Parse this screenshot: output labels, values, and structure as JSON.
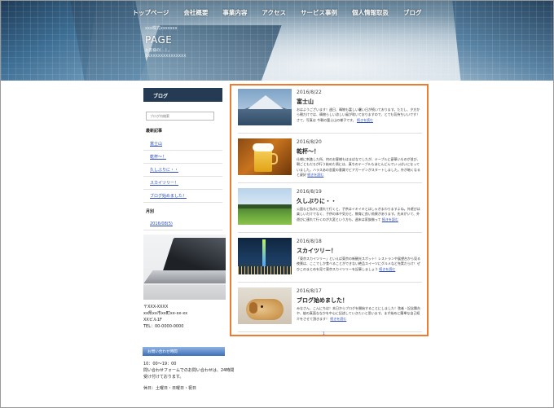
{
  "nav": {
    "items": [
      "トップページ",
      "会社概要",
      "事業内容",
      "アクセス",
      "サービス事例",
      "個人情報取扱",
      "ブログ"
    ]
  },
  "header": {
    "subtitle": "xxx株式xxxxxxx",
    "title": "PAGE",
    "desc_line1": "お客様の[…] 。",
    "desc_line2": "XXXXXXXXXXXXXXXX"
  },
  "sidebar": {
    "heading": "ブログ",
    "search_placeholder": "ブログ内検索",
    "recent_title": "最新記事",
    "recent": [
      "富士山",
      "乾杯～！",
      "久しぶりに・・",
      "スカイツリー！",
      "ブログ始めました！"
    ],
    "archive_title": "月別",
    "archive": [
      "2016/08(5)"
    ],
    "address": [
      "〒XXX-XXXX",
      "xx県xx市xx町xx-xx-xx",
      "XXビル1F",
      "TEL：00-0000-0000"
    ],
    "hours_heading": "お問い合わせ時間",
    "hours": [
      "10：00〜19：00",
      "問い合わせフォームでのお問い合わせは、24時間",
      "受け付けております。",
      "",
      "休日：土曜日・日曜日・祝日"
    ]
  },
  "posts": [
    {
      "date": "2016/8/22",
      "title": "富士山",
      "excerpt": "おはようございます！週日、晴物も富しい暑い日が続いております。ただし、夕方から朝だけでは、晴物らしい涼しい風が吹いておりますので、とても気持ちいいです！ さて、写真は 今朝の富士山の様子です。",
      "more": "続きを読む"
    },
    {
      "date": "2016/8/20",
      "title": "乾杯～！",
      "excerpt": "仕様に刺激した所、何のお客様もはまばなでしたが、テーブルに豪華いものが並び、朝ごともだろが行う始めた頃には、真ちのテーブルもほとんどんでいっぱいになっていました。ハラスあの恋愛の意識でビアガーデンがスタートしました。外が暗くなると豪好",
      "more": "続きを読む"
    },
    {
      "date": "2016/8/19",
      "title": "久しぶりに・・",
      "excerpt": "公園など私外に連れて行くと、子供はイキイキとはしゃぎまわりますよね。外遊びは楽しいだけでなく、子供の体や気分と、教育に良い効果があります。先末がいて、外遊びに連れて行くのが大変という方も、週末は家族揃って",
      "more": "続きを読む"
    },
    {
      "date": "2016/8/18",
      "title": "スカイツリー！",
      "excerpt": "「東京スカイツリー」といえば東京の新観光スポット！レストランや展望台から見る夜景は、ここでしか食べることができない絶品スイーツにグルメなど充実だらけ！ぜひこのまとめを見て東京スカイツリーを記事しましょう",
      "more": "続きを読む"
    },
    {
      "date": "2016/8/17",
      "title": "ブログ始めました！",
      "excerpt": "みなさん、こんにちは！本日からブログを開始することにしました！弦者・記念舞台や、彼の真面ななかを中心に記述していきたいと思います。まず始めに簡単な自己紹介をさせて頂きます！",
      "more": "続きを読む"
    }
  ],
  "pager": "1",
  "colors": {
    "accent": "#ee7b2f",
    "sidebar_head": "#243b53",
    "link": "#2a4bb8"
  }
}
